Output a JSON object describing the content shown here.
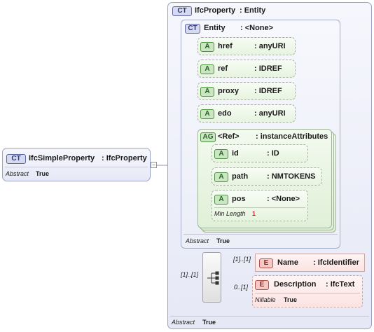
{
  "left": {
    "badge": "CT",
    "name": "IfcSimpleProperty",
    "type": ": IfcProperty",
    "props": [
      {
        "key": "Abstract",
        "value": "True"
      }
    ]
  },
  "outer": {
    "badge": "CT",
    "name": "IfcProperty",
    "type": ": Entity",
    "props": [
      {
        "key": "Abstract",
        "value": "True"
      }
    ]
  },
  "entity": {
    "badge": "CT",
    "name": "Entity",
    "type": ": <None>",
    "props": [
      {
        "key": "Abstract",
        "value": "True"
      }
    ]
  },
  "attributes": [
    {
      "badge": "A",
      "name": "href",
      "type": ": anyURI"
    },
    {
      "badge": "A",
      "name": "ref",
      "type": ": IDREF"
    },
    {
      "badge": "A",
      "name": "proxy",
      "type": ": IDREF"
    },
    {
      "badge": "A",
      "name": "edo",
      "type": ": anyURI"
    }
  ],
  "group": {
    "badge": "AG",
    "name": "<Ref>",
    "type": ": instanceAttributes",
    "attributes": [
      {
        "badge": "A",
        "name": "id",
        "type": ": ID"
      },
      {
        "badge": "A",
        "name": "path",
        "type": ": NMTOKENS"
      },
      {
        "badge": "A",
        "name": "pos",
        "type": ": <None>",
        "props": [
          {
            "key": "Min Length",
            "value": "1"
          }
        ]
      }
    ]
  },
  "sequence": {
    "occurrence": "[1]..[1]"
  },
  "elements": [
    {
      "badge": "E",
      "name": "Name",
      "type": ": IfcIdentifier",
      "occurrence": "[1]..[1]"
    },
    {
      "badge": "E",
      "name": "Description",
      "type": ": IfcText",
      "occurrence": "0..[1]",
      "props": [
        {
          "key": "Nillable",
          "value": "True"
        }
      ]
    }
  ]
}
